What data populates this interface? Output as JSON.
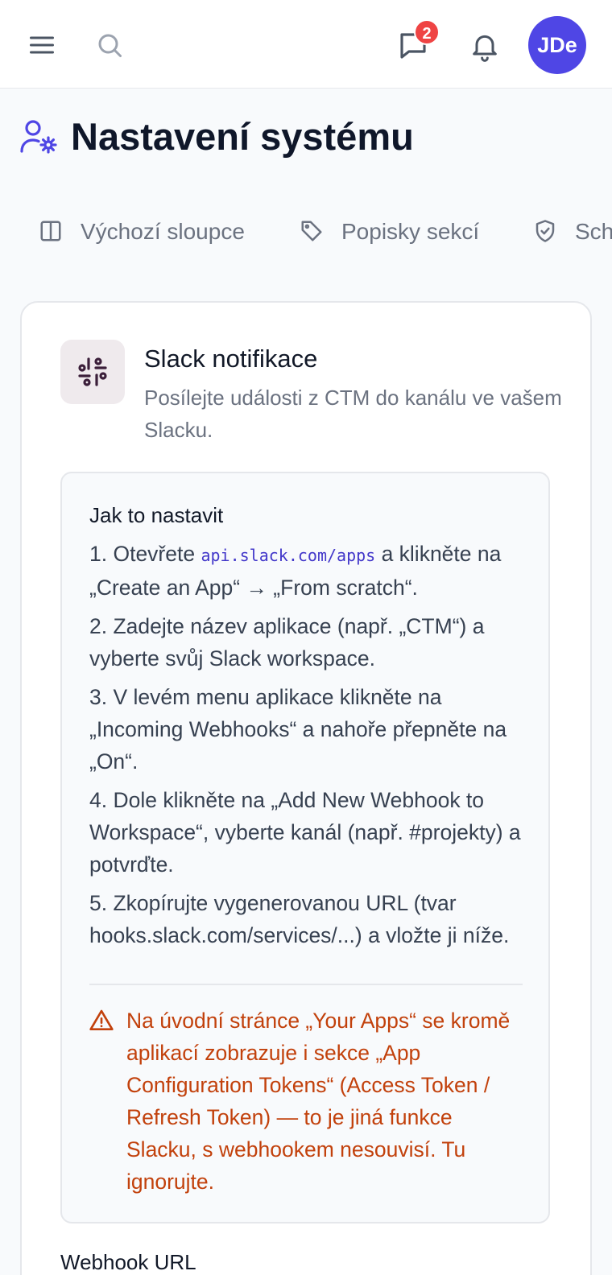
{
  "topbar": {
    "notification_count": "2",
    "avatar_initials": "JDe"
  },
  "page": {
    "title": "Nastavení systému"
  },
  "tabs": [
    {
      "label": "Výchozí sloupce",
      "icon": "columns-icon"
    },
    {
      "label": "Popisky sekcí",
      "icon": "tag-icon"
    },
    {
      "label": "Schválení",
      "icon": "shield-icon"
    }
  ],
  "slack": {
    "title": "Slack notifikace",
    "description": "Posílejte události z CTM do kanálu ve vašem Slacku.",
    "howto_title": "Jak to nastavit",
    "steps": {
      "s1_prefix": "1. Otevřete ",
      "s1_code": "api.slack.com/apps",
      "s1_suffix": " a klikněte na „Create an App“ → „From scratch“.",
      "s2": "2. Zadejte název aplikace (např. „CTM“) a vyberte svůj Slack workspace.",
      "s3": "3. V levém menu aplikace klikněte na „Incoming Webhooks“ a nahoře přepněte na „On“.",
      "s4": "4. Dole klikněte na „Add New Webhook to Workspace“, vyberte kanál (např. #projekty) a potvrďte.",
      "s5": "5. Zkopírujte vygenerovanou URL (tvar hooks.slack.com/services/...) a vložte ji níže."
    },
    "warning": "Na úvodní stránce „Your Apps“ se kromě aplikací zobrazuje i sekce „App Configuration Tokens“ (Access Token / Refresh Token) — to je jiná funkce Slacku, s webhookem nesouvisí. Tu ignorujte.",
    "webhook_label": "Webhook URL"
  },
  "colors": {
    "accent": "#4f46e5",
    "badge": "#ef4444",
    "warning": "#c2410c"
  }
}
